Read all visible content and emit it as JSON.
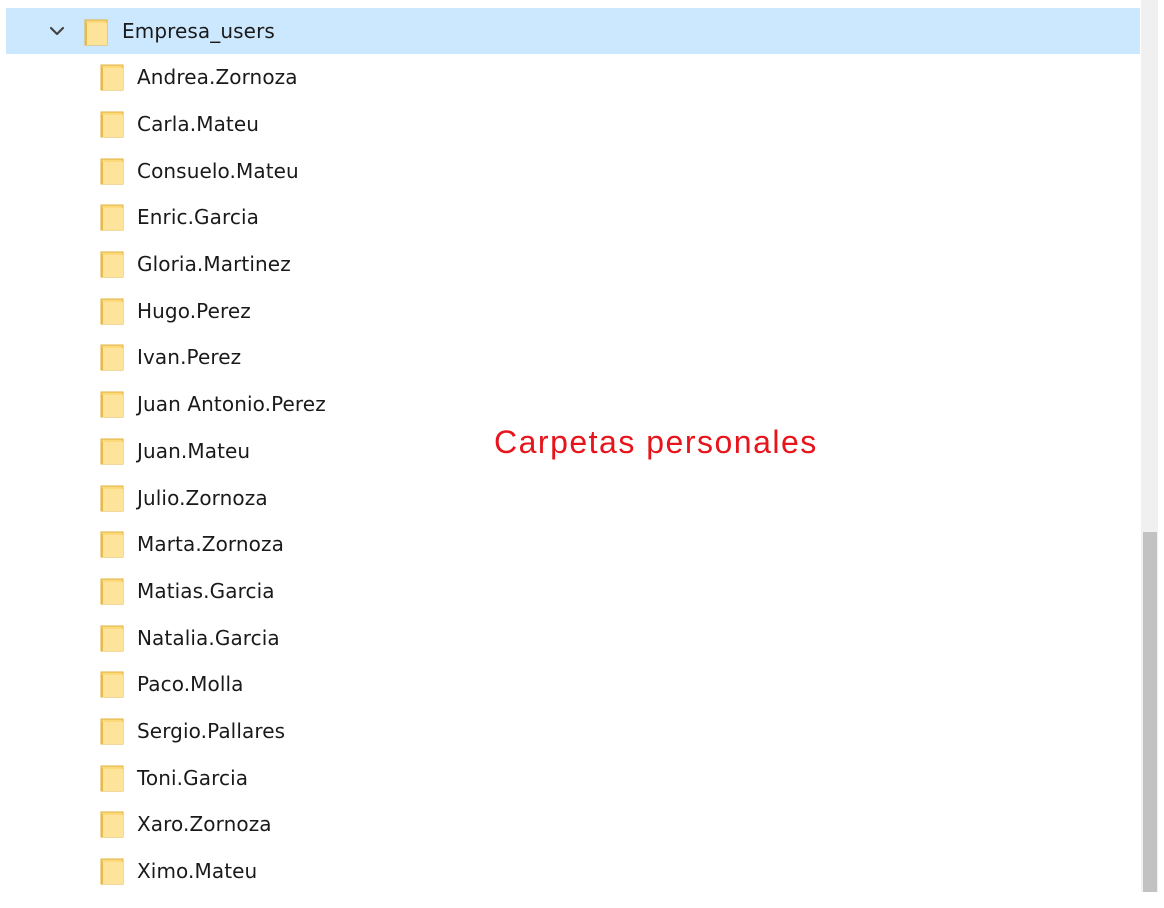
{
  "tree": {
    "parent": {
      "label": "Empresa_users",
      "icon": "folder-icon",
      "expander_icon": "chevron-down-icon",
      "selected": true
    },
    "children": [
      {
        "label": "Andrea.Zornoza",
        "icon": "folder-icon"
      },
      {
        "label": "Carla.Mateu",
        "icon": "folder-icon"
      },
      {
        "label": "Consuelo.Mateu",
        "icon": "folder-icon"
      },
      {
        "label": "Enric.Garcia",
        "icon": "folder-icon"
      },
      {
        "label": "Gloria.Martinez",
        "icon": "folder-icon"
      },
      {
        "label": "Hugo.Perez",
        "icon": "folder-icon"
      },
      {
        "label": "Ivan.Perez",
        "icon": "folder-icon"
      },
      {
        "label": "Juan Antonio.Perez",
        "icon": "folder-icon"
      },
      {
        "label": "Juan.Mateu",
        "icon": "folder-icon"
      },
      {
        "label": "Julio.Zornoza",
        "icon": "folder-icon"
      },
      {
        "label": "Marta.Zornoza",
        "icon": "folder-icon"
      },
      {
        "label": "Matias.Garcia",
        "icon": "folder-icon"
      },
      {
        "label": "Natalia.Garcia",
        "icon": "folder-icon"
      },
      {
        "label": "Paco.Molla",
        "icon": "folder-icon"
      },
      {
        "label": "Sergio.Pallares",
        "icon": "folder-icon"
      },
      {
        "label": "Toni.Garcia",
        "icon": "folder-icon"
      },
      {
        "label": "Xaro.Zornoza",
        "icon": "folder-icon"
      },
      {
        "label": "Ximo.Mateu",
        "icon": "folder-icon"
      }
    ]
  },
  "annotation": {
    "text": "Carpetas personales",
    "color": "#e8141c"
  },
  "colors": {
    "selection": "#cce8ff",
    "folder_fill": "#fcd97a",
    "folder_edge": "#e0b13e",
    "scrollbar_track": "#f0f0f0",
    "scrollbar_thumb": "#c2c2c2"
  }
}
